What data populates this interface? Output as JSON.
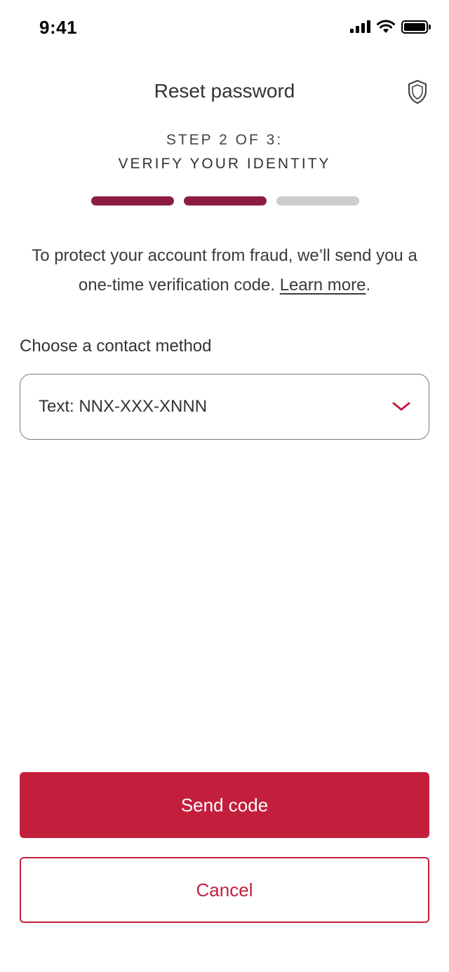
{
  "status_bar": {
    "time": "9:41",
    "icons": [
      "signal-icon",
      "wifi-icon",
      "battery-icon"
    ]
  },
  "header": {
    "title": "Reset password",
    "icon": "shield-icon"
  },
  "stepper": {
    "step_label": "STEP 2 OF 3:",
    "step_title": "VERIFY YOUR IDENTITY",
    "total_steps": 3,
    "completed_steps": 2,
    "colors": {
      "done": "#8c1d40",
      "todo": "#cccccc"
    }
  },
  "intro": {
    "text": "To protect your account from fraud, we’ll send you a one-time verification code. ",
    "link": "Learn more",
    "suffix": "."
  },
  "contact": {
    "label": "Choose a contact method",
    "selected": "Text: NNX-XXX-XNNN",
    "icon": "chevron-down-icon"
  },
  "actions": {
    "send_label": "Send code",
    "cancel_label": "Cancel"
  },
  "colors": {
    "accent": "#c41e3d",
    "progress": "#8c1d40"
  }
}
